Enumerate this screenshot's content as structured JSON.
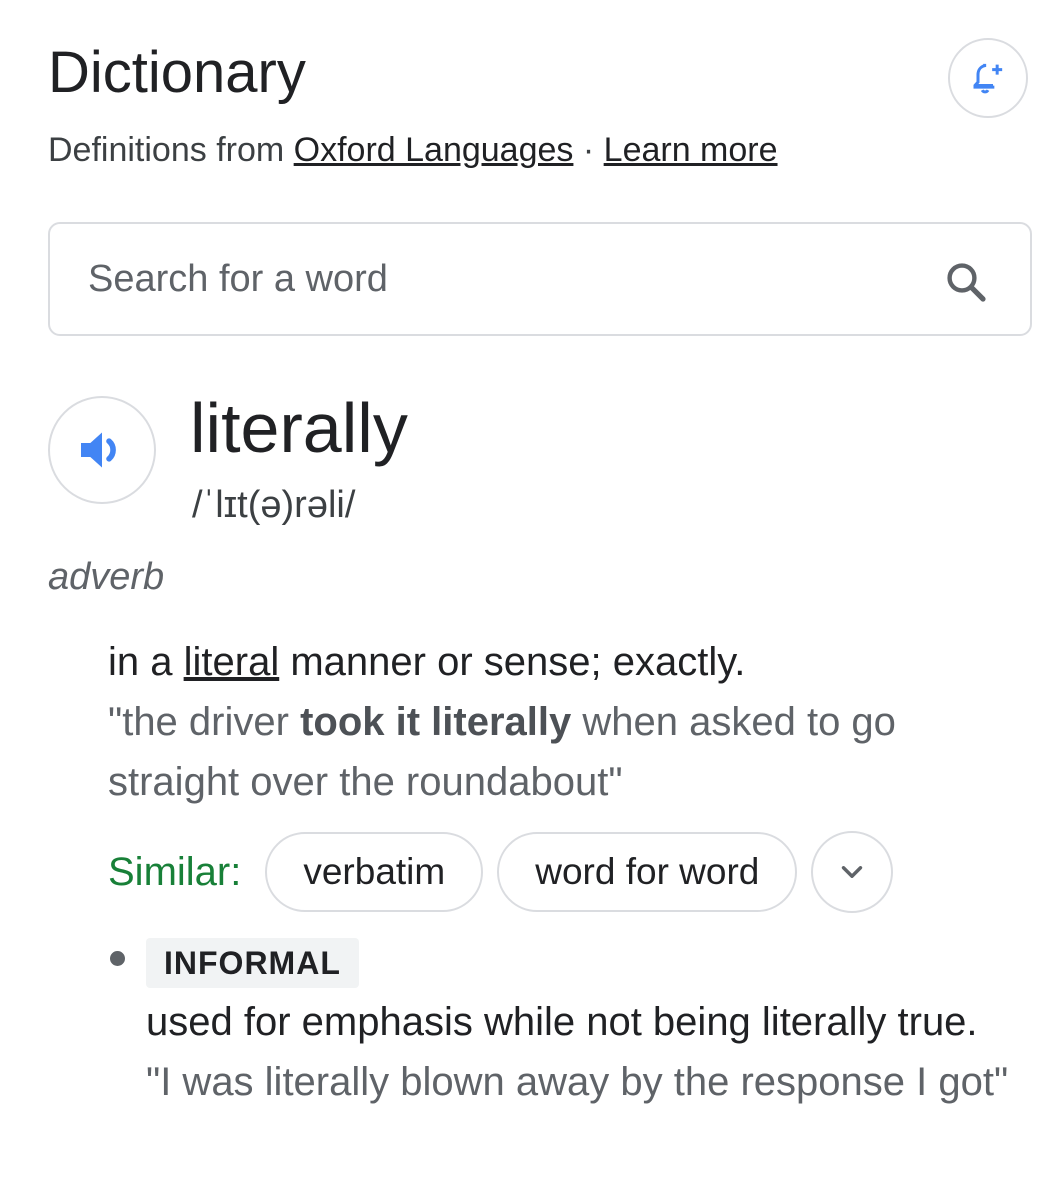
{
  "header": {
    "title": "Dictionary",
    "source_prefix": "Definitions from",
    "source_link": "Oxford Languages",
    "separator": "·",
    "learn_more": "Learn more",
    "alert_icon": "bell-plus-icon"
  },
  "search": {
    "placeholder": "Search for a word",
    "icon": "search-icon"
  },
  "entry": {
    "word": "literally",
    "phonetic": "/ˈlɪt(ə)rəli/",
    "pronounce_icon": "speaker-icon",
    "part_of_speech": "adverb",
    "senses": [
      {
        "definition_prefix": "in a",
        "definition_link": "literal",
        "definition_suffix": "manner or sense; exactly.",
        "example_start": "\"the driver",
        "example_bold": "took it literally",
        "example_end": "when asked to go straight over the roundabout\"",
        "similar_label": "Similar:",
        "similar": [
          "verbatim",
          "word for word"
        ],
        "expand_icon": "chevron-down-icon"
      },
      {
        "label": "INFORMAL",
        "definition": "used for emphasis while not being literally true.",
        "example": "\"I was literally blown away by the response I got\""
      }
    ]
  },
  "colors": {
    "accent_blue": "#4285f4",
    "similar_green": "#188038",
    "border": "#dadce0"
  }
}
